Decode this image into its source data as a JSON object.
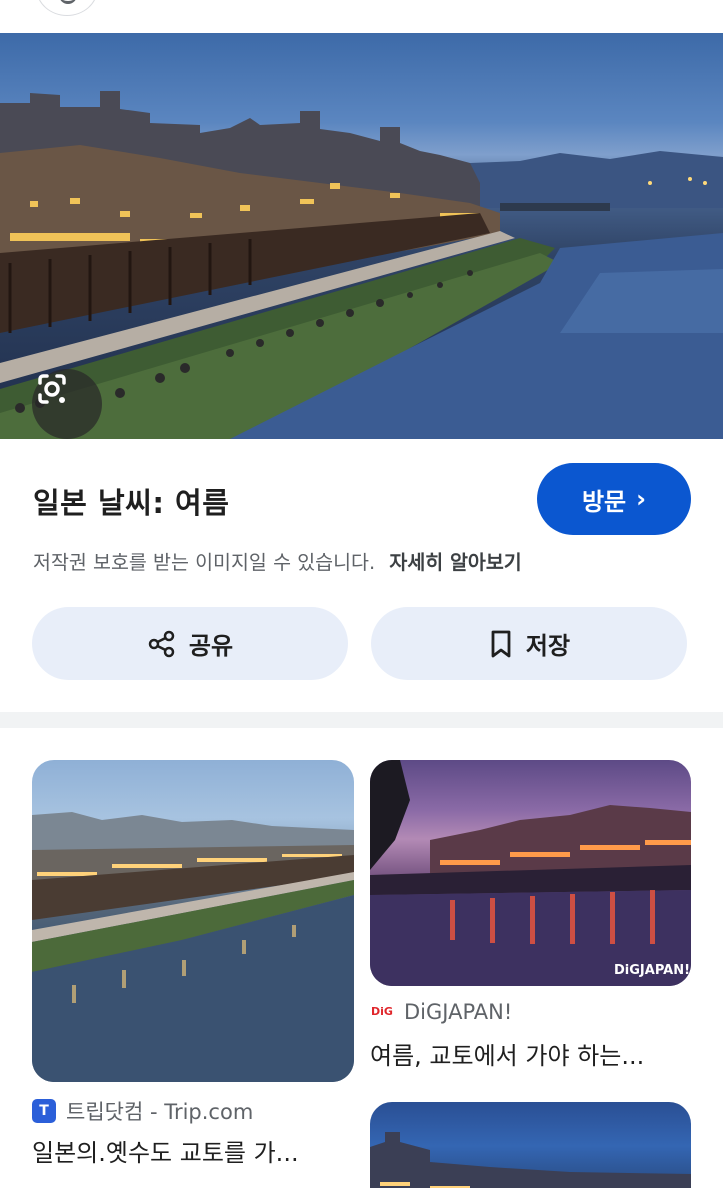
{
  "hero": {
    "image": "Kyoto Kamo River at dusk with riverside restaurants"
  },
  "title": "일본 날씨: 여름",
  "visit_button": {
    "label": "방문",
    "chevron": "›"
  },
  "copyright": {
    "text": "저작권 보호를 받는 이미지일 수 있습니다.",
    "learn_more": "자세히 알아보기"
  },
  "actions": {
    "share": "공유",
    "save": "저장"
  },
  "results": [
    {
      "source_icon": "T",
      "source": "트립닷컴 - Trip.com",
      "caption": "일본의.옛수도 교토를 가..."
    },
    {
      "source_icon": "DiG",
      "source": "DiGJAPAN!",
      "caption": "여름, 교토에서 가야 하는..."
    }
  ],
  "watermark": "DiGJAPAN!",
  "colors": {
    "accent": "#0b57d0",
    "chip_bg": "#e8eef9",
    "text_secondary": "#5f6368"
  }
}
